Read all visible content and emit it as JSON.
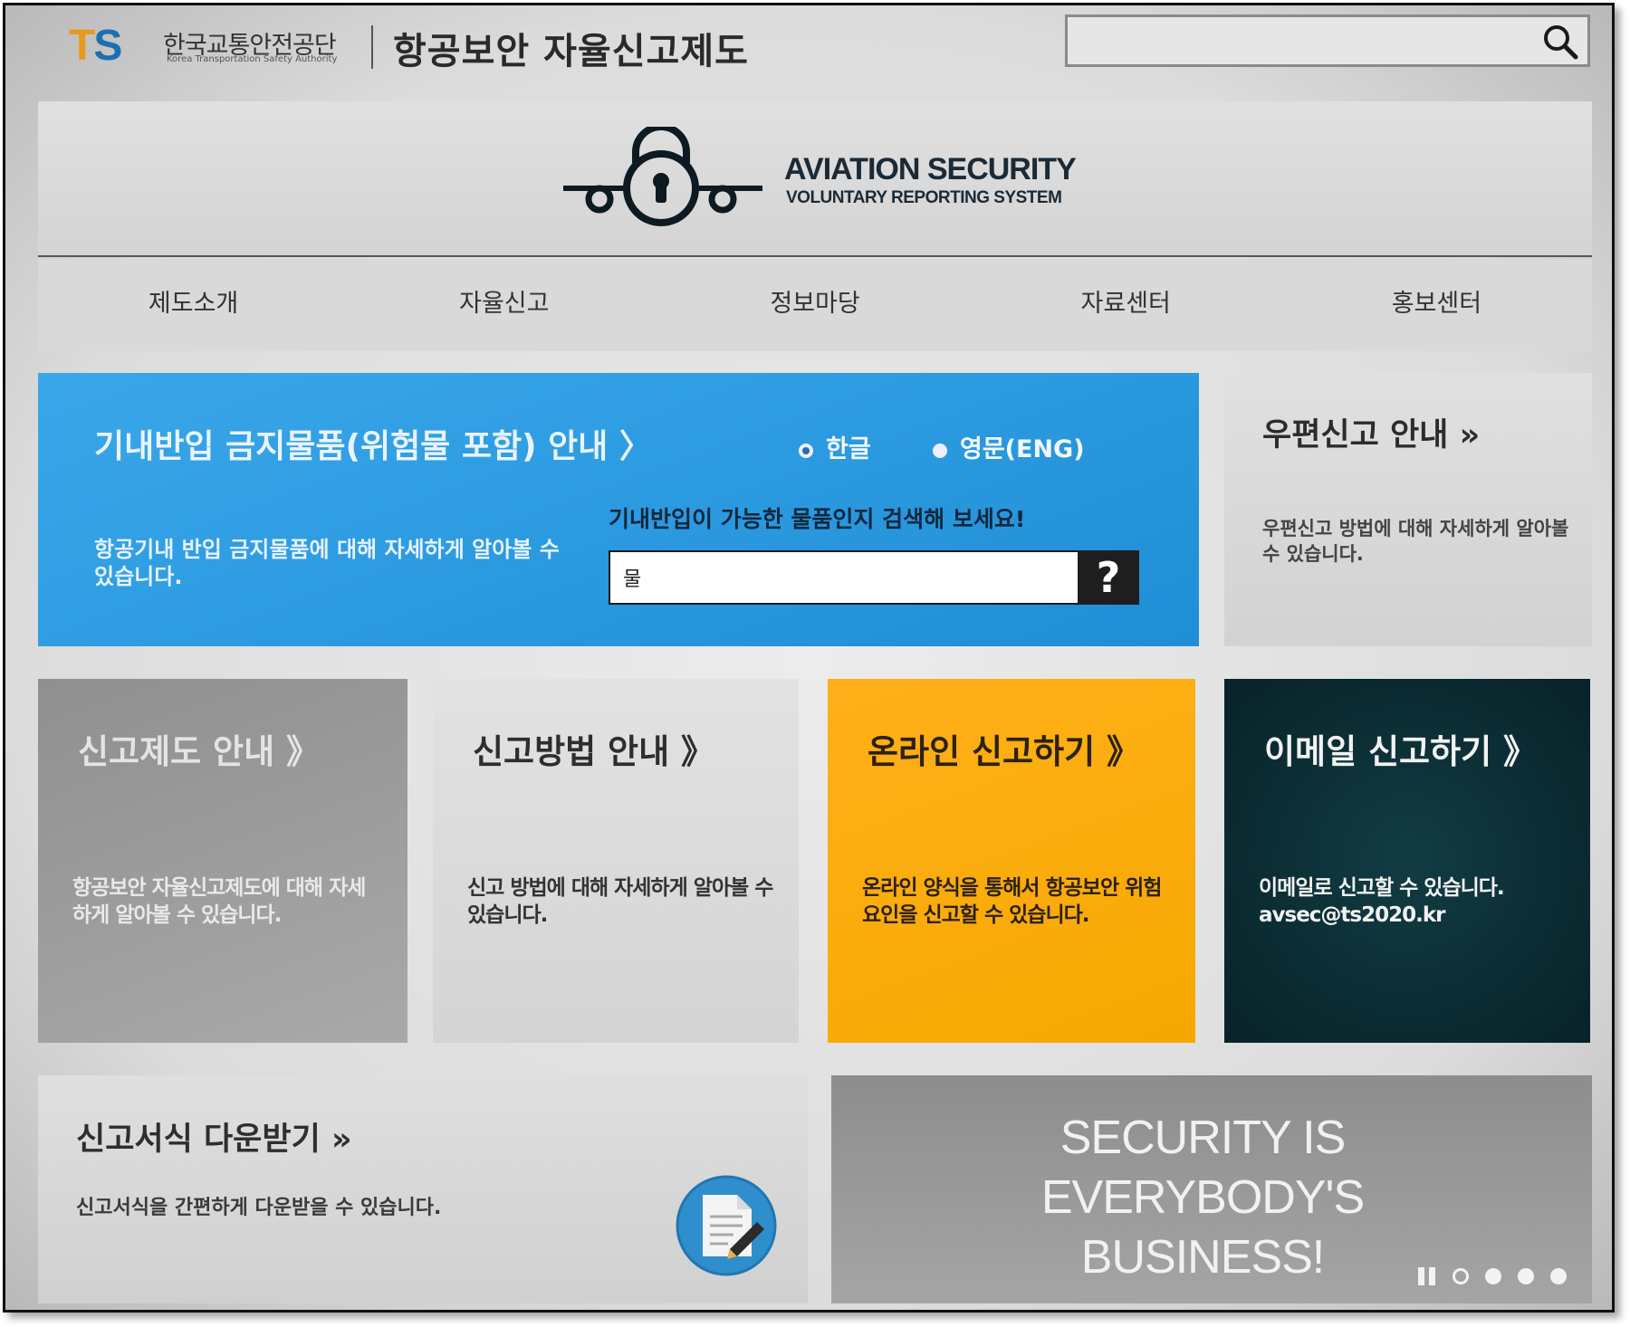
{
  "header": {
    "logo_mark": {
      "t": "T",
      "s": "S"
    },
    "logo_kr": "한국교통안전공단",
    "logo_en": "Korea Transportation Safety Authority",
    "title": "항공보안 자율신고제도",
    "search": {
      "value": "",
      "icon": "search-icon"
    }
  },
  "banner": {
    "line1": "AVIATION SECURITY",
    "line2": "VOLUNTARY REPORTING SYSTEM",
    "icon": "airplane-lock-icon"
  },
  "nav": {
    "items": [
      {
        "label": "제도소개"
      },
      {
        "label": "자율신고"
      },
      {
        "label": "정보마당"
      },
      {
        "label": "자료센터"
      },
      {
        "label": "홍보센터"
      }
    ]
  },
  "prohibited": {
    "title": "기내반입 금지물품(위험물 포함) 안내 〉",
    "description": "항공기내 반입 금지물품에 대해 자세하게 알아볼 수 있습니다.",
    "language_options": [
      {
        "label": "한글",
        "selected": true
      },
      {
        "label": "영문(ENG)",
        "selected": false
      }
    ],
    "search_prompt": "기내반입이 가능한 물품인지 검색해 보세요!",
    "search_value": "물",
    "help_label": "?",
    "colors": {
      "panel": "#2a9ae0"
    }
  },
  "postal": {
    "title": "우편신고 안내 »",
    "description": "우편신고 방법에 대해 자세하게 알아볼 수 있습니다."
  },
  "tiles": [
    {
      "title": "신고제도 안내 》",
      "description": "항공보안 자율신고제도에 대해 자세하게 알아볼 수 있습니다.",
      "color": "#9c9c9c"
    },
    {
      "title": "신고방법 안내 》",
      "description": "신고 방법에 대해 자세하게 알아볼 수 있습니다.",
      "color": "#dadada"
    },
    {
      "title": "온라인 신고하기 》",
      "description": "온라인 양식을 통해서 항공보안 위험요인을 신고할 수 있습니다.",
      "color": "#fbad0f"
    },
    {
      "title": "이메일 신고하기 》",
      "description": "이메일로 신고할 수 있습니다. avsec@ts2020.kr",
      "color": "#0c2f36"
    }
  ],
  "download": {
    "title": "신고서식 다운받기 »",
    "description": "신고서식을 간편하게 다운받을 수 있습니다.",
    "icon": "document-edit-icon"
  },
  "slide": {
    "lines": [
      "SECURITY IS",
      "EVERYBODY'S",
      "BUSINESS!"
    ],
    "controls": {
      "pause_icon": "pause-icon",
      "dot_count": 4,
      "active_dot": 1
    }
  }
}
